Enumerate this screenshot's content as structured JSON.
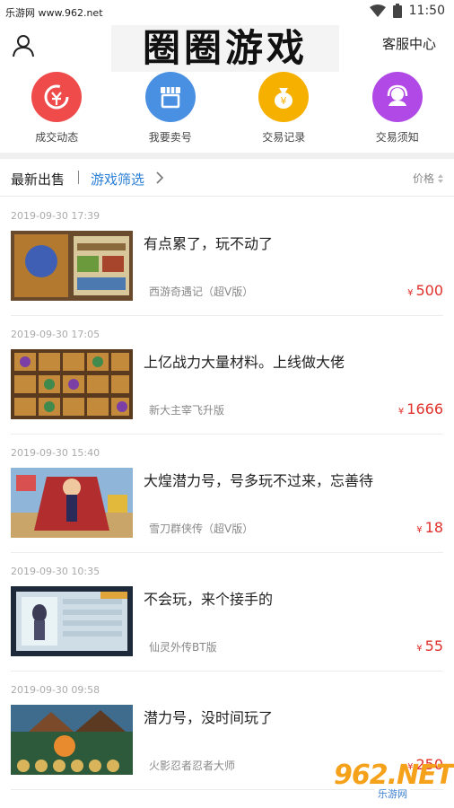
{
  "status_bar": {
    "watermark_text": "乐游网 www.962.net",
    "time": "11:50"
  },
  "header": {
    "title": "圈圈游戏",
    "service_label": "客服中心"
  },
  "quick_entries": [
    {
      "label": "成交动态",
      "icon": "exchange-icon",
      "color": "#ef4b4b"
    },
    {
      "label": "我要卖号",
      "icon": "shop-icon",
      "color": "#4a90e2"
    },
    {
      "label": "交易记录",
      "icon": "moneybag-icon",
      "color": "#f5b000"
    },
    {
      "label": "交易须知",
      "icon": "headset-icon",
      "color": "#b049e6"
    }
  ],
  "filter_bar": {
    "latest_label": "最新出售",
    "filter_label": "游戏筛选",
    "sort_label": "价格"
  },
  "listings": [
    {
      "date": "2019-09-30 17:39",
      "title": "有点累了，玩不动了",
      "game": "西游奇遇记（超V版）",
      "currency": "¥",
      "price": "500"
    },
    {
      "date": "2019-09-30 17:05",
      "title": "上亿战力大量材料。上线做大佬",
      "game": "新大主宰飞升版",
      "currency": "¥",
      "price": "1666"
    },
    {
      "date": "2019-09-30 15:40",
      "title": "大煌潜力号，号多玩不过来，忘善待",
      "game": "雪刀群侠传（超V版）",
      "currency": "¥",
      "price": "18"
    },
    {
      "date": "2019-09-30 10:35",
      "title": "不会玩，来个接手的",
      "game": "仙灵外传BT版",
      "currency": "¥",
      "price": "55"
    },
    {
      "date": "2019-09-30 09:58",
      "title": "潜力号，没时间玩了",
      "game": "火影忍者忍者大师",
      "currency": "¥",
      "price": "250"
    }
  ],
  "watermark": {
    "logo": "962.NET",
    "sub": "乐游网"
  }
}
